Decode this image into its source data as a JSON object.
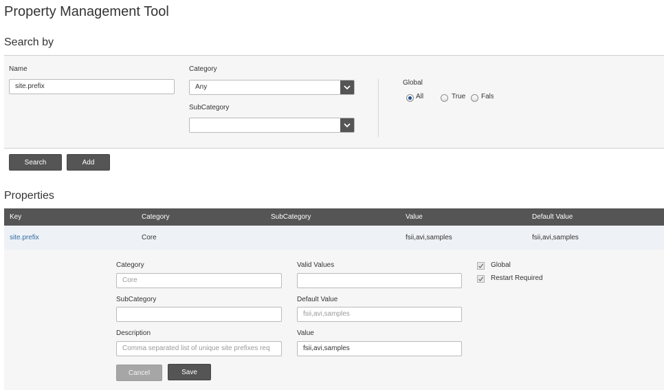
{
  "page": {
    "title": "Property Management Tool"
  },
  "search": {
    "section_title": "Search by",
    "name_label": "Name",
    "name_value": "site.prefix",
    "category_label": "Category",
    "category_value": "Any",
    "subcategory_label": "SubCategory",
    "subcategory_value": "",
    "global_label": "Global",
    "global_options": [
      "All",
      "True",
      "Fals"
    ],
    "global_selected": "All",
    "search_button": "Search",
    "add_button": "Add"
  },
  "properties": {
    "section_title": "Properties",
    "columns": [
      "Key",
      "Category",
      "SubCategory",
      "Value",
      "Default Value"
    ],
    "rows": [
      {
        "key": "site.prefix",
        "category": "Core",
        "subcategory": "",
        "value": "fsii,avi,samples",
        "default_value": "fsii,avi,samples"
      }
    ]
  },
  "editor": {
    "category_label": "Category",
    "category_value": "Core",
    "subcategory_label": "SubCategory",
    "subcategory_value": "",
    "description_label": "Description",
    "description_value": "Comma separated list of unique site prefixes req",
    "valid_values_label": "Valid Values",
    "valid_values_value": "",
    "default_value_label": "Default Value",
    "default_value_value": "fsii,avi,samples",
    "value_label": "Value",
    "value_value": "fsii,avi,samples",
    "global_label": "Global",
    "global_checked": true,
    "restart_label": "Restart Required",
    "restart_checked": true,
    "cancel_button": "Cancel",
    "save_button": "Save"
  },
  "colors": {
    "header_bg": "#555555",
    "link": "#2e6da4",
    "panel_bg": "#f6f6f6",
    "row_bg": "#eef2f6"
  }
}
